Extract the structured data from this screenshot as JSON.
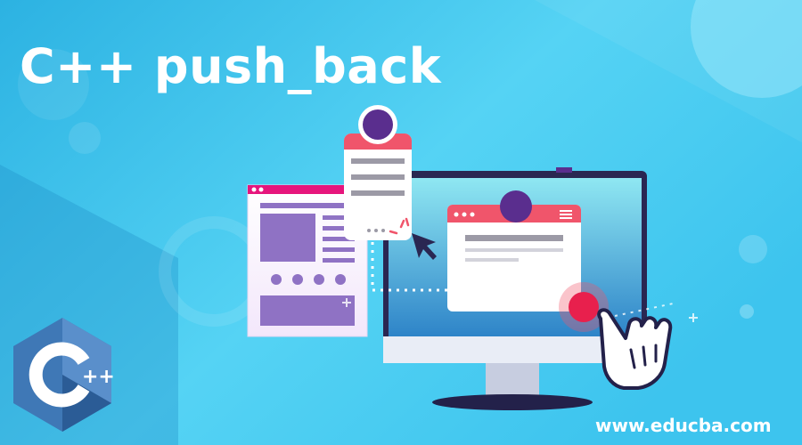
{
  "banner": {
    "title": "C++ push_back",
    "site_url": "www.educba.com",
    "logo_text": "++"
  },
  "colors": {
    "background_light": "#4fd6f3",
    "background_dark": "#27a9dc",
    "monitor_frame": "#2a2752",
    "accent_pink": "#f0556b",
    "accent_purple": "#5a2e8e",
    "panel_purple": "#8f72c4",
    "logo_blue": "#3f78b6"
  },
  "icons": [
    "cpp-logo-icon",
    "hand-cursor-icon",
    "arrow-cursor-icon",
    "hamburger-menu-icon",
    "avatar-icon",
    "plus-sparkle-icon"
  ]
}
